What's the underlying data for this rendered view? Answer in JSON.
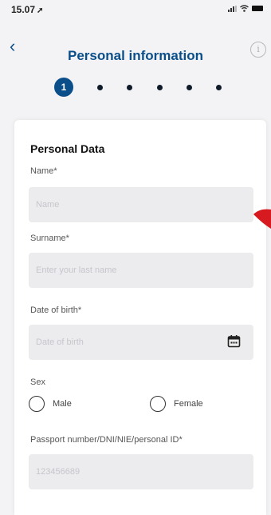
{
  "status_bar": {
    "time": "15.07",
    "location_glyph": "➚"
  },
  "header": {
    "back_label": "‹",
    "title": "Personal information",
    "info_label": "i"
  },
  "stepper": {
    "current": "1",
    "total_steps": 6,
    "active_color": "#0b4f8a"
  },
  "form": {
    "section_title": "Personal Data",
    "name": {
      "label": "Name*",
      "placeholder": "Name"
    },
    "surname": {
      "label": "Surname*",
      "placeholder": "Enter your last name"
    },
    "dob": {
      "label": "Date of birth*",
      "placeholder": "Date of birth"
    },
    "sex": {
      "label": "Sex",
      "options": [
        "Male",
        "Female"
      ]
    },
    "passport": {
      "label": "Passport number/DNI/NIE/personal ID*",
      "placeholder": "123456689"
    }
  },
  "colors": {
    "brand": "#0b4f8a",
    "pointer": "#d61a1f"
  },
  "icons": {
    "back": "chevron-left-icon",
    "info": "info-icon",
    "calendar": "calendar-icon"
  }
}
